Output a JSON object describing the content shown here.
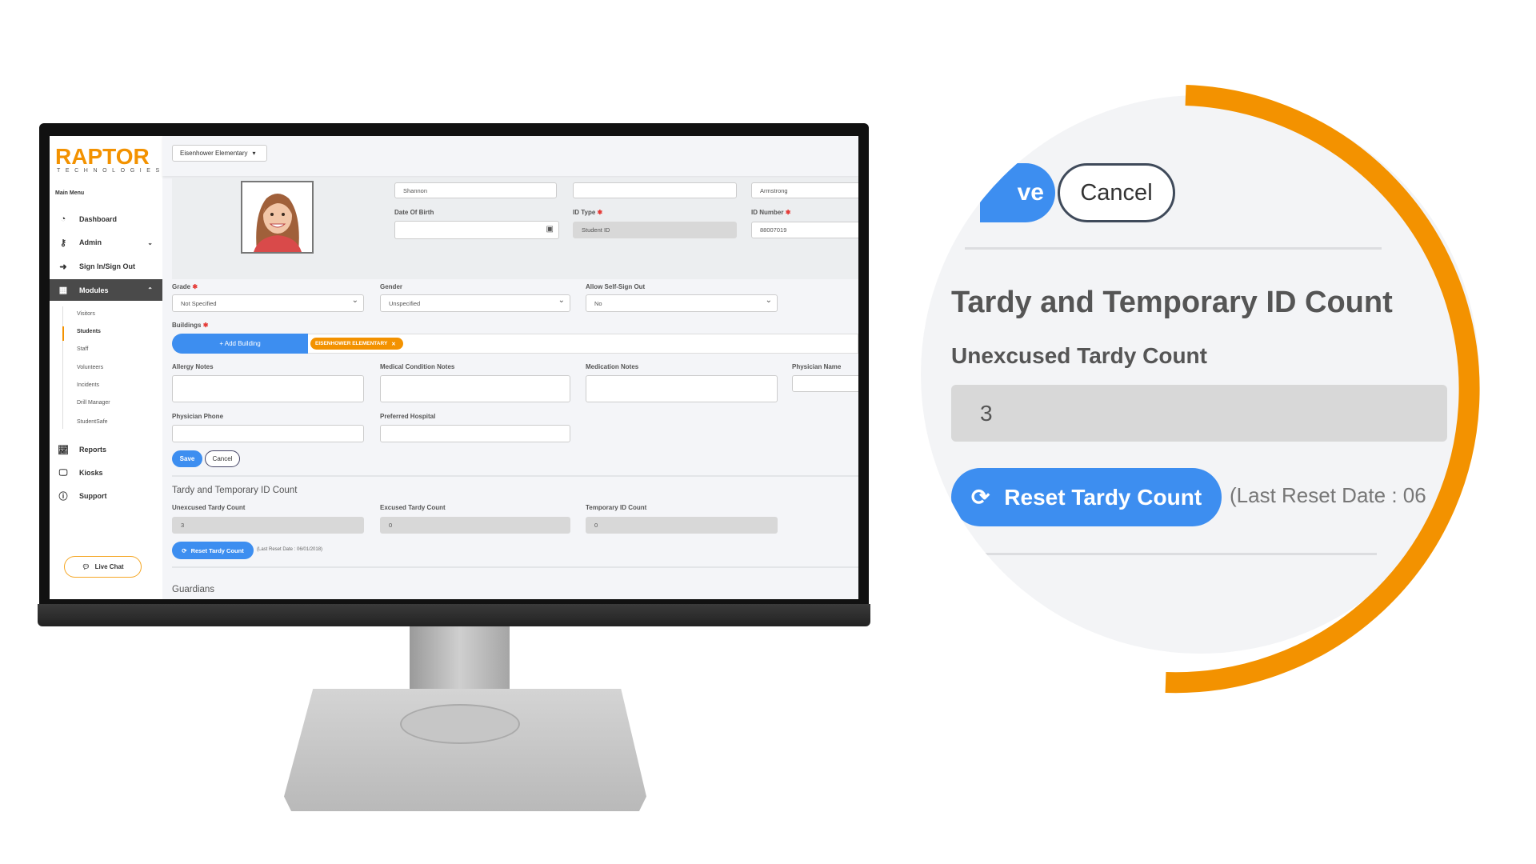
{
  "brand": {
    "name": "RAPTOR",
    "tagline": "TECHNOLOGIES",
    "accent": "#f39200",
    "primary": "#3d8ef0"
  },
  "sidebar": {
    "heading": "Main Menu",
    "items": [
      {
        "label": "Dashboard",
        "icon": "dashboard-icon"
      },
      {
        "label": "Admin",
        "icon": "key-icon"
      },
      {
        "label": "Sign In/Sign Out",
        "icon": "sign-in-icon"
      },
      {
        "label": "Modules",
        "icon": "grid-icon"
      },
      {
        "label": "Reports",
        "icon": "chart-icon"
      },
      {
        "label": "Kiosks",
        "icon": "monitor-icon"
      },
      {
        "label": "Support",
        "icon": "help-icon"
      }
    ],
    "modules": [
      "Visitors",
      "Students",
      "Staff",
      "Volunteers",
      "Incidents",
      "Drill Manager",
      "StudentSafe"
    ],
    "active_module": "Students",
    "live_chat": "Live Chat"
  },
  "topbar": {
    "building_select": "Eisenhower Elementary"
  },
  "student": {
    "first_name": "Shannon",
    "middle_name": "",
    "last_name": "Armstrong",
    "dob_label": "Date Of Birth",
    "dob": "",
    "id_type_label": "ID Type",
    "id_type": "Student ID",
    "id_number_label": "ID Number",
    "id_number": "88007019",
    "grade_label": "Grade",
    "grade": "Not Specified",
    "gender_label": "Gender",
    "gender": "Unspecified",
    "self_signout_label": "Allow Self-Sign Out",
    "self_signout": "No",
    "buildings_label": "Buildings",
    "add_building": "+  Add Building",
    "building_chip": "EISENHOWER ELEMENTARY",
    "allergy_label": "Allergy Notes",
    "medical_label": "Medical Condition Notes",
    "medication_label": "Medication Notes",
    "physician_name_label": "Physician Name",
    "physician_phone_label": "Physician Phone",
    "hospital_label": "Preferred Hospital",
    "save": "Save",
    "cancel": "Cancel"
  },
  "tardy": {
    "title": "Tardy and Temporary ID Count",
    "unexcused_label": "Unexcused Tardy Count",
    "unexcused": "3",
    "excused_label": "Excused Tardy Count",
    "excused": "0",
    "temp_label": "Temporary ID Count",
    "temp": "0",
    "reset": "Reset Tardy Count",
    "last_reset": "(Last Reset Date : 06/01/2018)"
  },
  "guardians": {
    "title": "Guardians"
  },
  "zoom": {
    "save_partial": "ve",
    "cancel": "Cancel",
    "title": "Tardy and Temporary ID Count",
    "label": "Unexcused Tardy Count",
    "value": "3",
    "reset": "Reset Tardy Count",
    "last_reset_partial": "(Last Reset Date : 06"
  }
}
